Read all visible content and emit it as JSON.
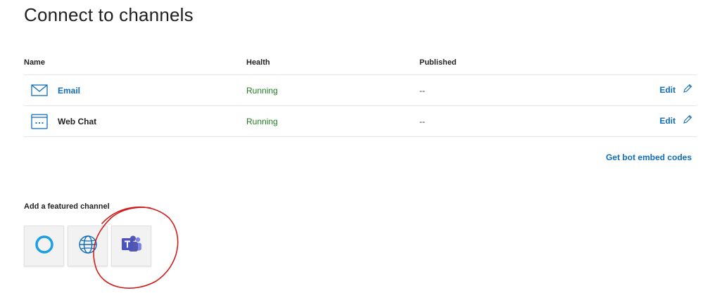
{
  "page": {
    "title": "Connect to channels"
  },
  "table": {
    "headers": {
      "name": "Name",
      "health": "Health",
      "published": "Published"
    },
    "rows": [
      {
        "icon": "email-icon",
        "name": "Email",
        "health": "Running",
        "published": "--",
        "edit_label": "Edit"
      },
      {
        "icon": "web-chat-icon",
        "name": "Web Chat",
        "health": "Running",
        "published": "--",
        "edit_label": "Edit"
      }
    ]
  },
  "embed": {
    "label": "Get bot embed codes"
  },
  "featured": {
    "title": "Add a featured channel",
    "channels": [
      {
        "icon": "cortana-icon"
      },
      {
        "icon": "globe-icon"
      },
      {
        "icon": "teams-icon"
      }
    ]
  },
  "colors": {
    "link": "#0f6cbd",
    "running": "#1e7d1e",
    "teams": "#5558af",
    "cortana": "#1ba1e2",
    "annotation": "#d11a1a"
  }
}
